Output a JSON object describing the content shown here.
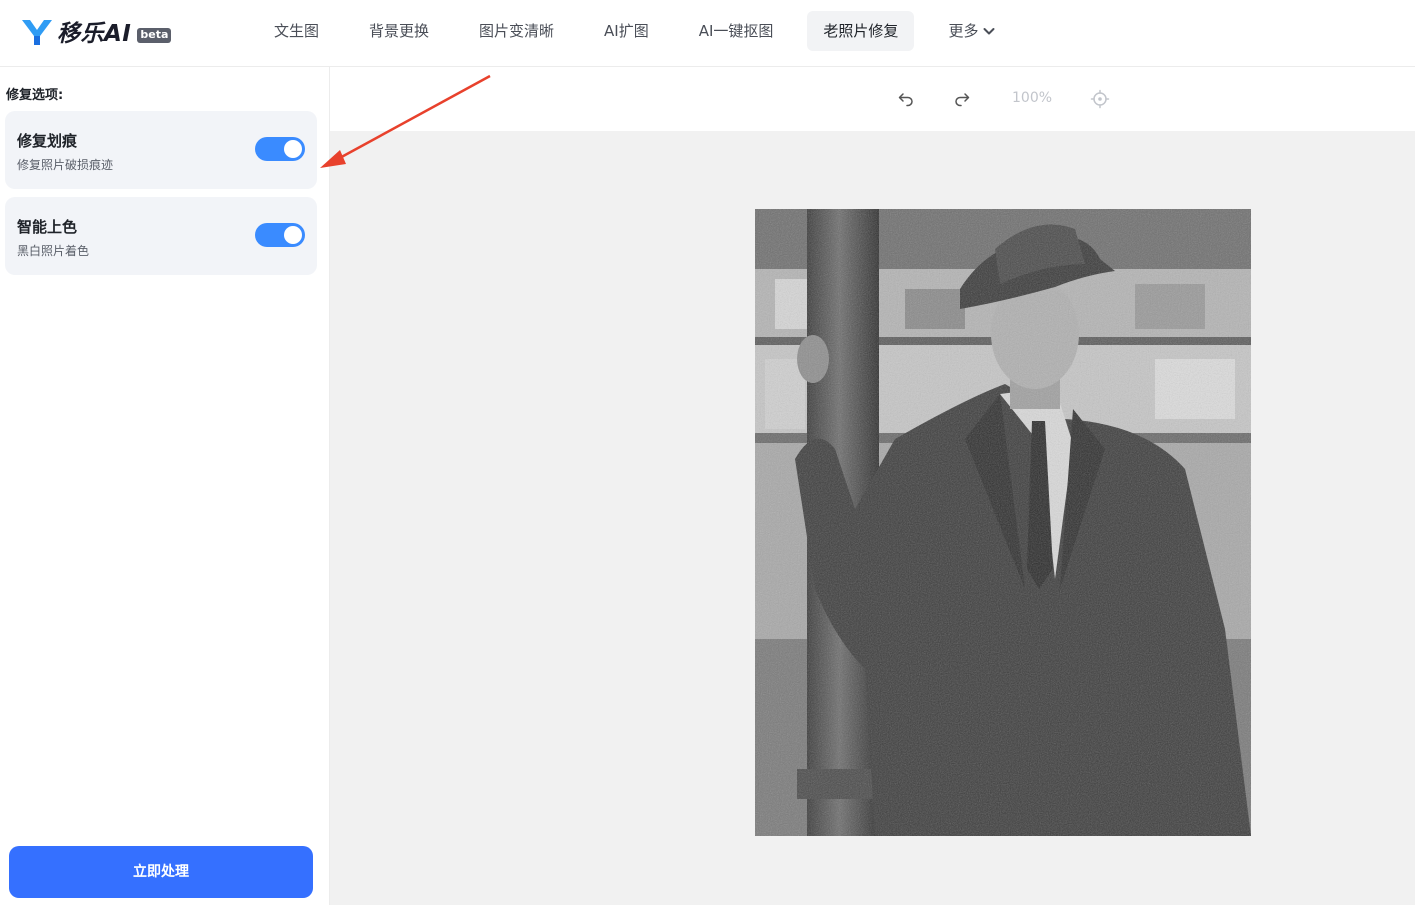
{
  "header": {
    "logo_text": "移乐AI",
    "logo_badge": "beta",
    "nav": [
      {
        "label": "文生图"
      },
      {
        "label": "背景更换"
      },
      {
        "label": "图片变清晰"
      },
      {
        "label": "AI扩图"
      },
      {
        "label": "AI一键抠图"
      },
      {
        "label": "老照片修复",
        "active": true
      },
      {
        "label": "更多"
      }
    ]
  },
  "left_panel": {
    "section_title": "修复选项:",
    "options": [
      {
        "title": "修复划痕",
        "desc": "修复照片破损痕迹",
        "enabled": true
      },
      {
        "title": "智能上色",
        "desc": "黑白照片着色",
        "enabled": true
      }
    ],
    "process_button": "立即处理"
  },
  "toolbar": {
    "undo_icon": "undo-icon",
    "redo_icon": "redo-icon",
    "zoom": "100%",
    "locate_icon": "crosshair-icon"
  },
  "colors": {
    "accent": "#3a8bff",
    "button": "#3570ff",
    "annotation_arrow": "#e8412c"
  }
}
